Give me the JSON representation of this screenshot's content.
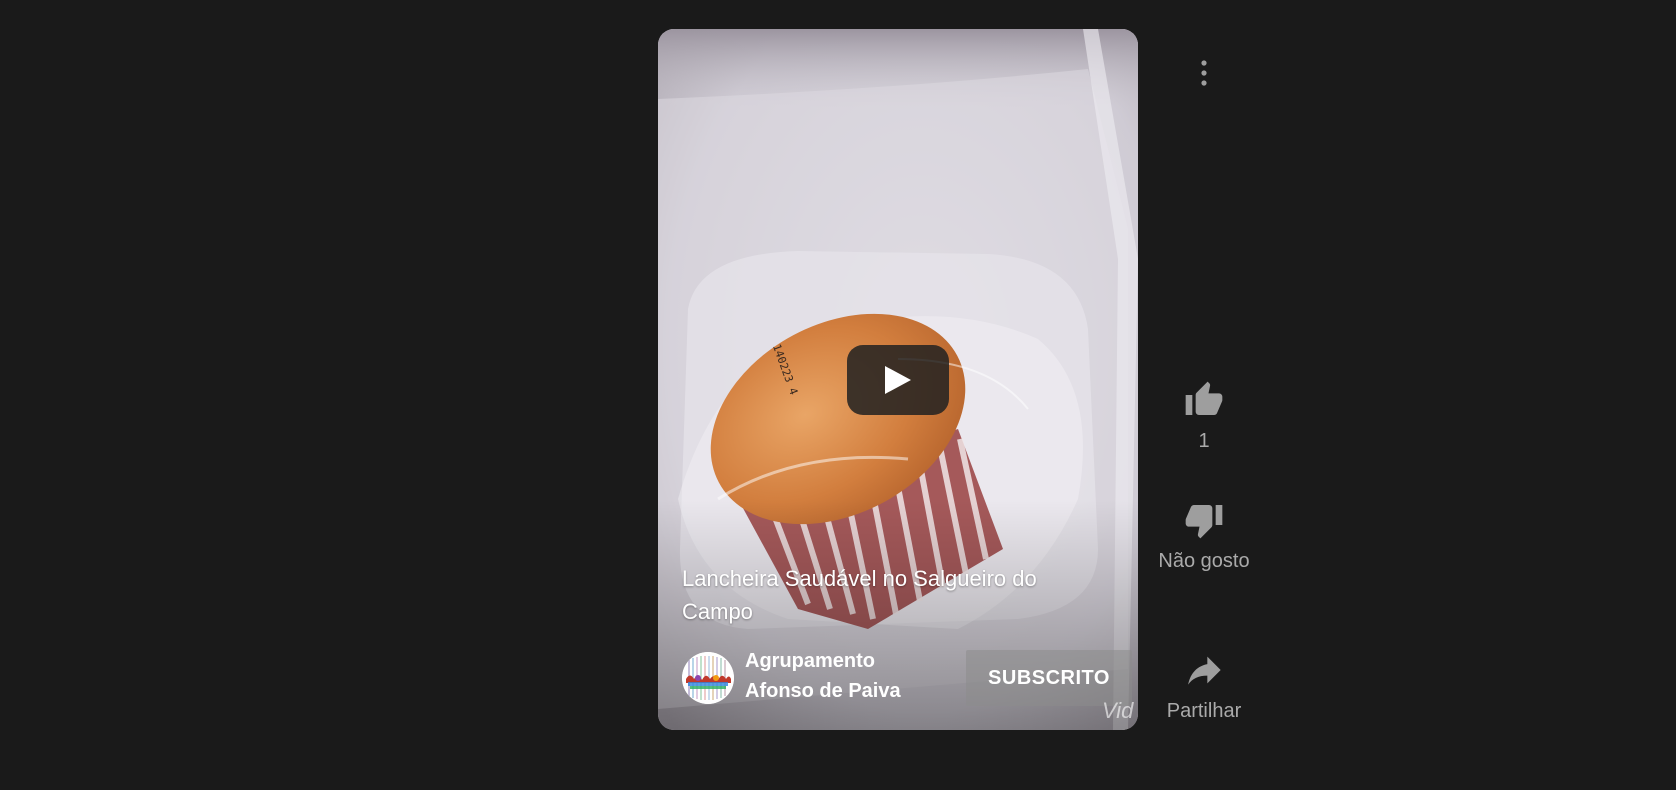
{
  "video": {
    "title": "Lancheira Saudável no Salgueiro do Campo",
    "watermark": "Vid"
  },
  "channel": {
    "name": "Agrupamento Afonso de Paiva",
    "subscribe_label": "SUBSCRITO"
  },
  "actions": {
    "like_count": "1",
    "dislike_label": "Não gosto",
    "share_label": "Partilhar"
  },
  "colors": {
    "background": "#1a1a1a",
    "action_text": "#aaaaaa",
    "icon_gray": "#9e9e9e"
  },
  "icons": {
    "menu": "more-vert-icon",
    "like": "thumb-up-icon",
    "dislike": "thumb-down-icon",
    "share": "share-arrow-icon",
    "play": "play-icon"
  }
}
